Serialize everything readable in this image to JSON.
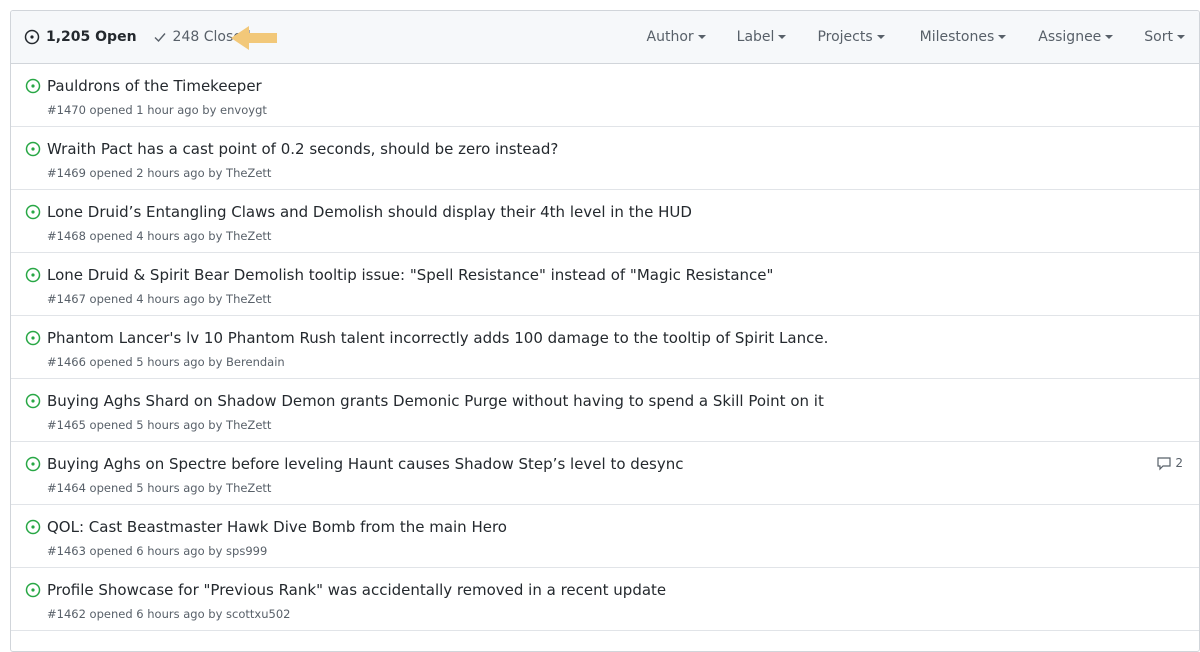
{
  "header": {
    "open_label": "1,205 Open",
    "closed_label": "248 Closed",
    "filters": [
      "Author",
      "Label",
      "Projects",
      "Milestones",
      "Assignee",
      "Sort"
    ]
  },
  "issues": [
    {
      "title": "Pauldrons of the Timekeeper",
      "meta": "#1470 opened 1 hour ago by envoygt",
      "comments": ""
    },
    {
      "title": "Wraith Pact has a cast point of 0.2 seconds, should be zero instead?",
      "meta": "#1469 opened 2 hours ago by TheZett",
      "comments": ""
    },
    {
      "title": "Lone Druid’s Entangling Claws and Demolish should display their 4th level in the HUD",
      "meta": "#1468 opened 4 hours ago by TheZett",
      "comments": ""
    },
    {
      "title": "Lone Druid & Spirit Bear Demolish tooltip issue: \"Spell Resistance\" instead of \"Magic Resistance\"",
      "meta": "#1467 opened 4 hours ago by TheZett",
      "comments": ""
    },
    {
      "title": "Phantom Lancer's lv 10 Phantom Rush talent incorrectly adds 100 damage to the tooltip of Spirit Lance.",
      "meta": "#1466 opened 5 hours ago by Berendain",
      "comments": ""
    },
    {
      "title": "Buying Aghs Shard on Shadow Demon grants Demonic Purge without having to spend a Skill Point on it",
      "meta": "#1465 opened 5 hours ago by TheZett",
      "comments": ""
    },
    {
      "title": "Buying Aghs on Spectre before leveling Haunt causes Shadow Step’s level to desync",
      "meta": "#1464 opened 5 hours ago by TheZett",
      "comments": "2"
    },
    {
      "title": "QOL: Cast Beastmaster Hawk Dive Bomb from the main Hero",
      "meta": "#1463 opened 6 hours ago by sps999",
      "comments": ""
    },
    {
      "title": "Profile Showcase for \"Previous Rank\" was accidentally removed in a recent update",
      "meta": "#1462 opened 6 hours ago by scottxu502",
      "comments": ""
    }
  ],
  "colors": {
    "open_green": "#28a745",
    "arrow": "#f2c879"
  }
}
